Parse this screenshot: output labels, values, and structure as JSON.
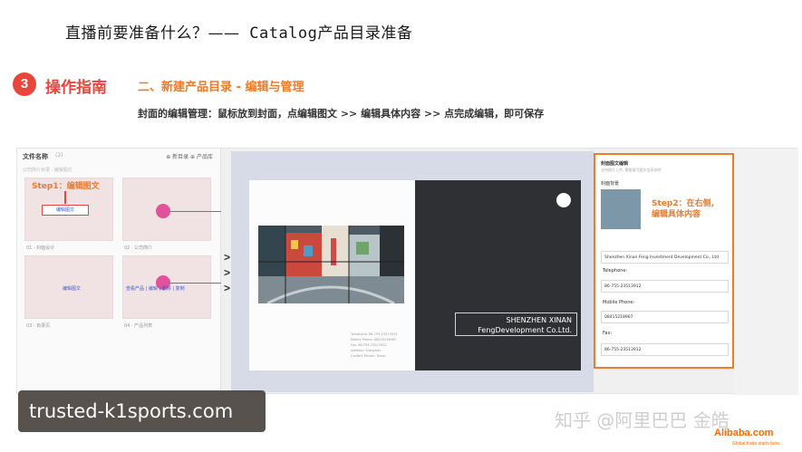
{
  "header": {
    "title_cn": "直播前要准备什么？——",
    "title_en": " Catalog",
    "title_suffix": "产品目录准备"
  },
  "step": {
    "number": "3",
    "title": "操作指南",
    "section": "二、新建产品目录 - 编辑与管理",
    "instruction": "封面的编辑管理：鼠标放到封面，点编辑图文 >> 编辑具体内容 >> 点完成编辑，即可保存"
  },
  "screenshot": {
    "left_panel": {
      "header": "文件名称",
      "count": "(2)",
      "actions": "⊕ 新目录  ⊕ 产品库",
      "subtitle": "公司简介目录  ·  编辑图文",
      "step1_label": "Step1：编辑图文",
      "edit_button": "编辑图文",
      "thumb_labels": [
        "01 · 封面设计",
        "02 · 公司简介",
        "03 · 目录页",
        "04 · 产品列表"
      ],
      "edit_links": "查看产品  |  编辑  |  删除  |  复制"
    },
    "chevrons": [
      ">",
      ">",
      ">"
    ],
    "cover": {
      "company_line1": "SHENZHEN XINAN",
      "company_line2": "FengDevelopment Co.Ltd.",
      "small_lines": [
        "Telephone: 86-755-23513912",
        "Mobile Phone: 08415218967",
        "Fax: 86-755-23513912",
        "Address: Shenzhen",
        "Contact Person: Xinan"
      ]
    },
    "right_panel": {
      "title": "封面图文编辑",
      "subtitle": "支持图片上传, 需要填写图文信息说明",
      "cover_label": "封面背景",
      "step2_line1": "Step2：在右侧,",
      "step2_line2": "编辑具体内容",
      "fields": [
        {
          "value": "Shenzhen Xinan Feng Investment Development Co., Ltd"
        },
        {
          "label": "Telephone:",
          "value": "86-755-23513912"
        },
        {
          "label": "Mobile Phone:",
          "value": "08415218967"
        },
        {
          "label": "Fax:",
          "value": "86-755-23513912"
        }
      ]
    }
  },
  "watermark": "trusted-k1sports.com",
  "credit": "知乎 @阿里巴巴 金皓",
  "brand": {
    "name": "Alibaba.com",
    "tagline": "Global trade starts here."
  },
  "colors": {
    "accent_red": "#e8453c",
    "accent_orange": "#ee7a2b"
  }
}
